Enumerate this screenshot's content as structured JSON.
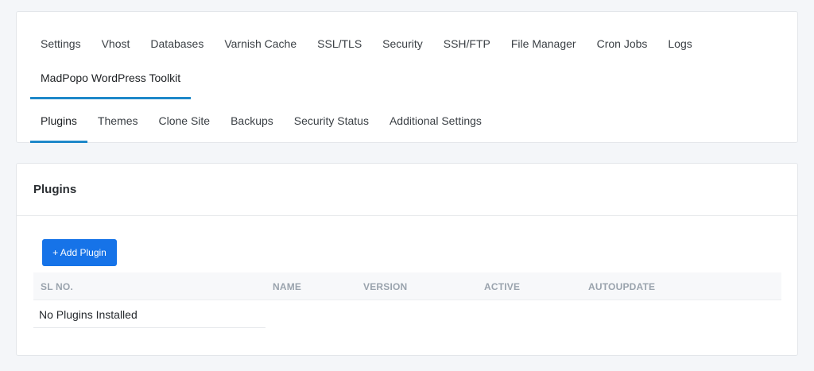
{
  "tabs_main": [
    {
      "label": "Settings"
    },
    {
      "label": "Vhost"
    },
    {
      "label": "Databases"
    },
    {
      "label": "Varnish Cache"
    },
    {
      "label": "SSL/TLS"
    },
    {
      "label": "Security"
    },
    {
      "label": "SSH/FTP"
    },
    {
      "label": "File Manager"
    },
    {
      "label": "Cron Jobs"
    },
    {
      "label": "Logs"
    }
  ],
  "tab_toolkit": {
    "label": "MadPopo WordPress Toolkit",
    "active": true
  },
  "tabs_sub": [
    {
      "label": "Plugins",
      "active": true
    },
    {
      "label": "Themes"
    },
    {
      "label": "Clone Site"
    },
    {
      "label": "Backups"
    },
    {
      "label": "Security Status"
    },
    {
      "label": "Additional Settings"
    }
  ],
  "plugins": {
    "title": "Plugins",
    "add_button_label": "+ Add Plugin",
    "columns": [
      "SL NO.",
      "NAME",
      "VERSION",
      "ACTIVE",
      "AUTOUPDATE"
    ],
    "empty_message": "No Plugins Installed"
  },
  "colors": {
    "accent": "#1e88c9",
    "button": "#1673e8",
    "header_text": "#9aa3ad"
  }
}
